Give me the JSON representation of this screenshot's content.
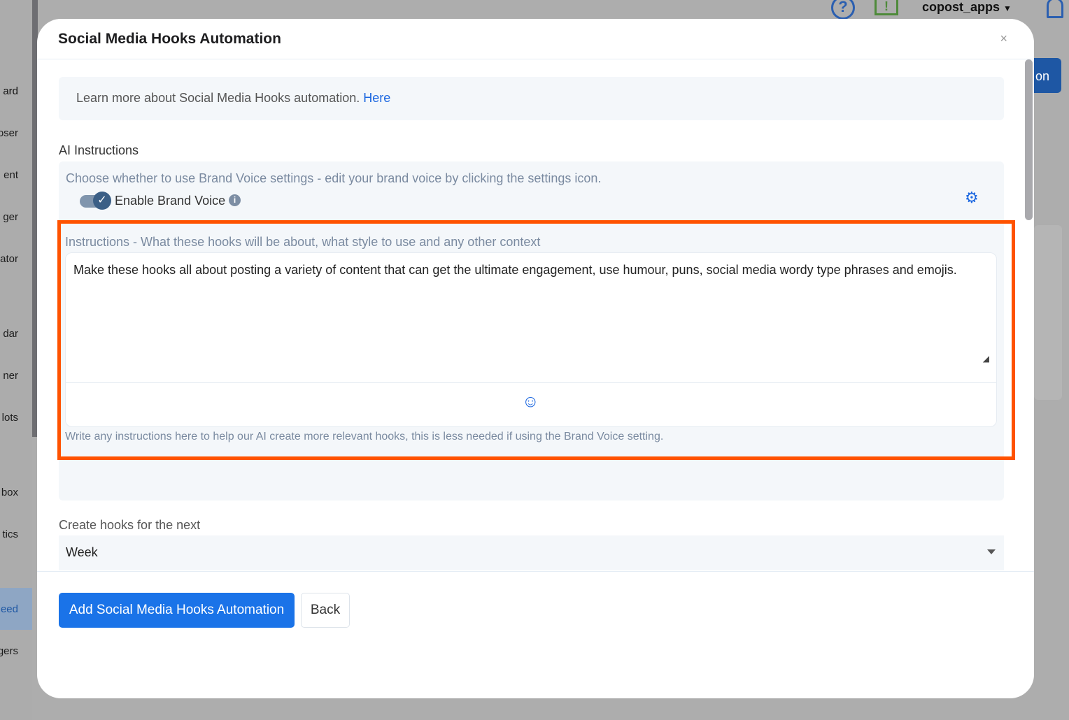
{
  "background": {
    "sidebar_items": [
      "ard",
      "oser",
      "ent",
      "ger",
      "ator",
      "dar",
      "ner",
      "lots",
      "box",
      "tics",
      "eed",
      "gers"
    ],
    "user": "copost_apps",
    "partial_button": "on"
  },
  "modal": {
    "title": "Social Media Hooks Automation",
    "close": "×",
    "info_text": "Learn more about Social Media Hooks automation.",
    "info_link": "Here",
    "ai_label": "AI Instructions",
    "brand_hint": "Choose whether to use Brand Voice settings - edit your brand voice by clicking the settings icon.",
    "brand_toggle_label": "Enable Brand Voice",
    "brand_enabled": true,
    "instructions_label": "Instructions - What these hooks will be about, what style to use and any other context",
    "instructions_value": "Make these hooks all about posting a variety of content that can get the ultimate engagement, use humour, puns, social media wordy type phrases and emojis.",
    "instructions_help": "Write any instructions here to help our AI create more relevant hooks, this is less needed if using the Brand Voice setting.",
    "period_label": "Create hooks for the next",
    "period_value": "Week",
    "submit": "Add Social Media Hooks Automation",
    "back": "Back"
  },
  "colors": {
    "accent": "#1a73e8",
    "highlight": "#ff5200"
  }
}
